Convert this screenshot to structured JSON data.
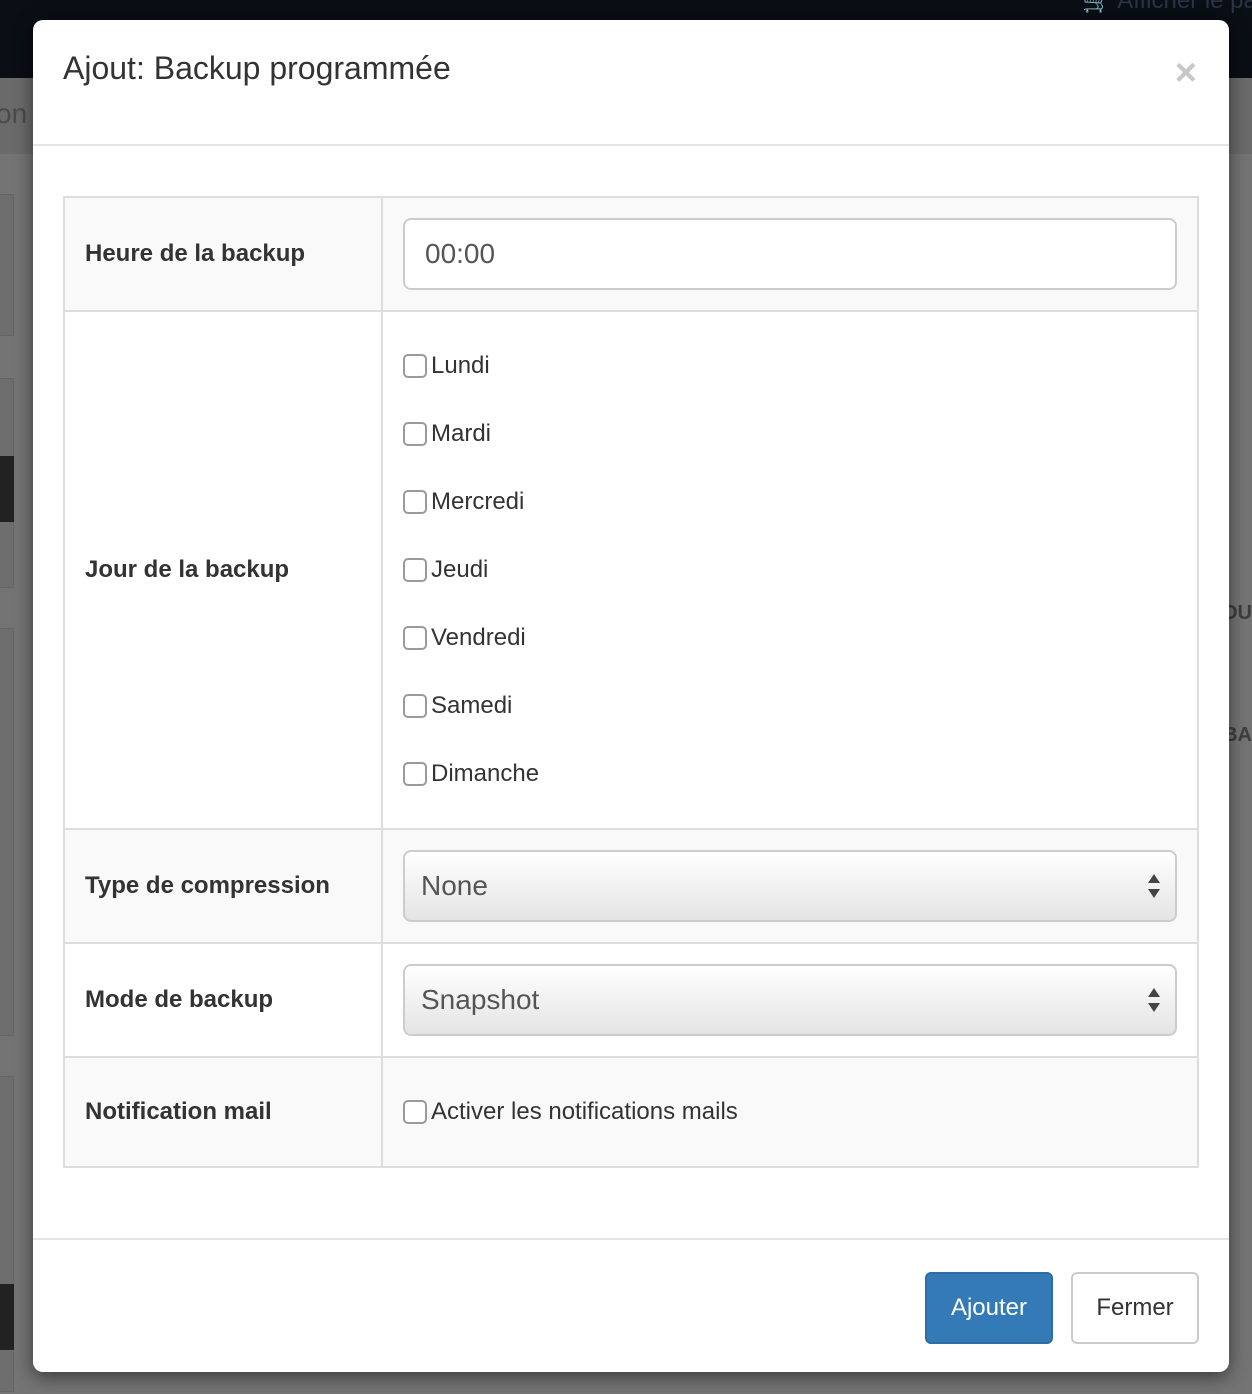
{
  "background": {
    "topbar_link": "🛒 Afficher le pa",
    "subbar_text": "on",
    "right_texts": [
      "OU",
      "BA"
    ]
  },
  "modal": {
    "title": "Ajout: Backup programmée",
    "close_label": "×",
    "rows": {
      "time": {
        "label": "Heure de la backup",
        "value": "00:00"
      },
      "days": {
        "label": "Jour de la backup",
        "options": [
          {
            "label": "Lundi",
            "checked": false
          },
          {
            "label": "Mardi",
            "checked": false
          },
          {
            "label": "Mercredi",
            "checked": false
          },
          {
            "label": "Jeudi",
            "checked": false
          },
          {
            "label": "Vendredi",
            "checked": false
          },
          {
            "label": "Samedi",
            "checked": false
          },
          {
            "label": "Dimanche",
            "checked": false
          }
        ]
      },
      "compression": {
        "label": "Type de compression",
        "selected": "None"
      },
      "mode": {
        "label": "Mode de backup",
        "selected": "Snapshot"
      },
      "notification": {
        "label": "Notification mail",
        "checkbox_label": "Activer les notifications mails",
        "checked": false
      }
    },
    "footer": {
      "submit_label": "Ajouter",
      "close_label": "Fermer"
    }
  }
}
